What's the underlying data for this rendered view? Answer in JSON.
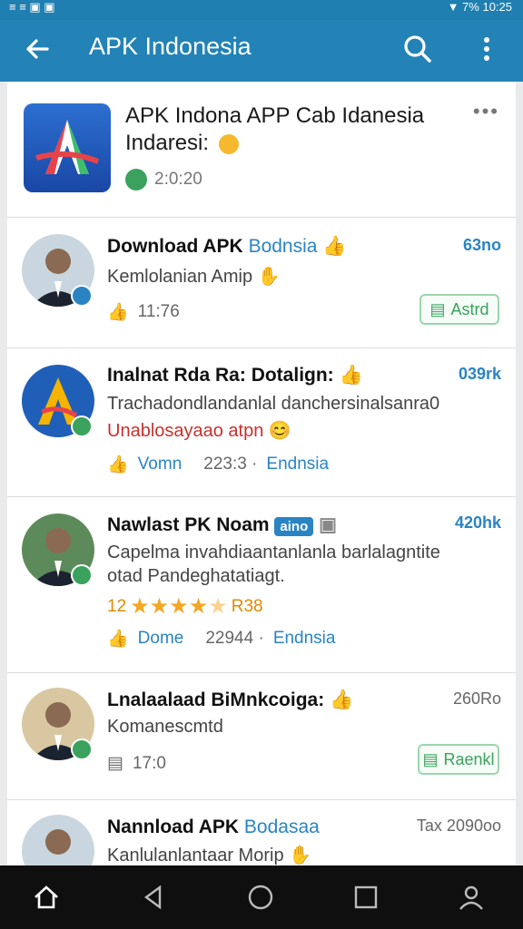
{
  "status_bar": {
    "left": "≡ ≡ ▣ ▣",
    "right": "▼ 7% 10:25"
  },
  "app_bar": {
    "title": "APK Indonesia"
  },
  "header": {
    "title_line1": "APK Indona APP Cab Idanesia",
    "title_line2": "Indaresi:",
    "meta": "2:0:20"
  },
  "items": [
    {
      "title": "Download APK",
      "title_highlight": "Bodnsia",
      "count": "63no",
      "subtitle": "Kemlolanian Amip",
      "meta_time": "11:76",
      "button": "Astrd"
    },
    {
      "title": "Inalnat Rda Ra: Dotalign:",
      "count": "039rk",
      "subtitle": "Trachadondlandanlal danchersinalsanra0",
      "subtitle_red": "Unablosayaao atpn",
      "meta_label": "Vomn",
      "meta_num": "223:3 ·",
      "meta_link": "Endnsia"
    },
    {
      "title": "Nawlast PK Noam",
      "title_chip": "aino",
      "count": "420hk",
      "subtitle": "Capelma invahdiaantanlanla barlalagntite",
      "subtitle2": "otad Pandeghatatiagt.",
      "rating_num": "12",
      "rating": 4.5,
      "rating_after": "R38",
      "meta_label": "Dome",
      "meta_num": "22944 ·",
      "meta_link": "Endnsia"
    },
    {
      "title": "Lnalaalaad BiMnkcoiga:",
      "count": "260Ro",
      "subtitle": "Komanescmtd",
      "meta_time": "17:0",
      "button": "Raenkl"
    },
    {
      "title": "Nannload APK",
      "title_highlight": "Bodasaa",
      "count": "Tax 2090oo",
      "subtitle": "Kanlulanlantaar Morip"
    }
  ]
}
